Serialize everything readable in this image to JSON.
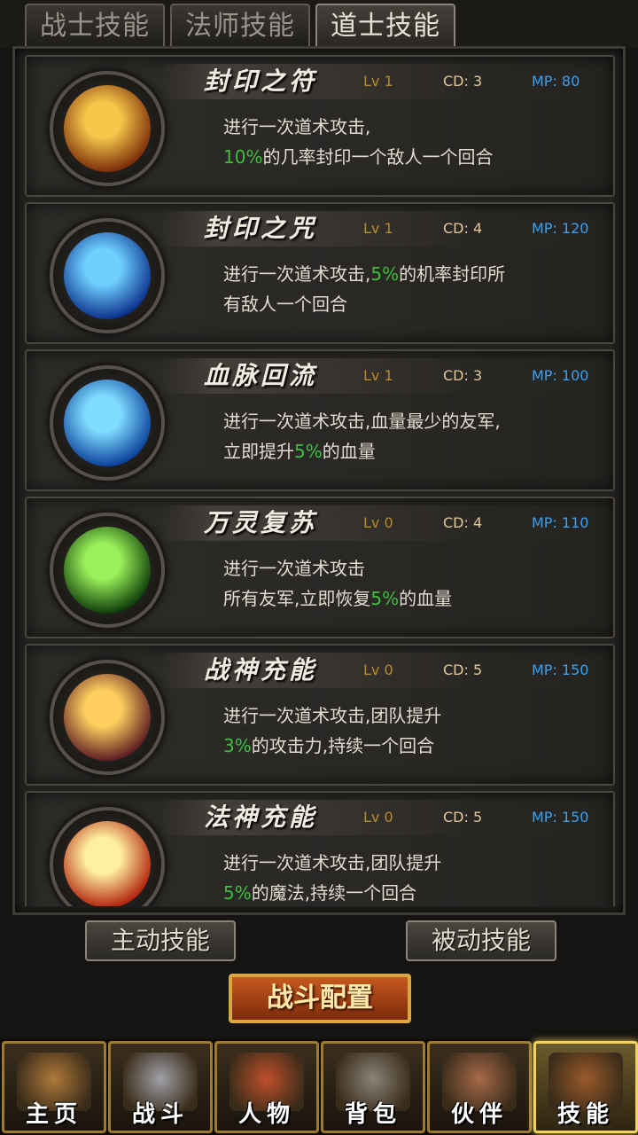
{
  "tabs": [
    "战士技能",
    "法师技能",
    "道士技能"
  ],
  "active_tab": 2,
  "skills": [
    {
      "name": "封印之符",
      "lv": "Lv 1",
      "cd": "CD: 3",
      "mp": "MP: 80",
      "desc1a": "进行一次道术攻击,",
      "desc1g": "",
      "desc1b": "",
      "desc2a": "",
      "desc2g": "10%",
      "desc2b": "的几率封印一个敌人一个回合",
      "icon": "golden-talisman-icon",
      "color1": "#f5c84a",
      "color2": "#7a2a08"
    },
    {
      "name": "封印之咒",
      "lv": "Lv 1",
      "cd": "CD: 4",
      "mp": "MP: 120",
      "desc1a": "进行一次道术攻击,",
      "desc1g": "5%",
      "desc1b": "的机率封印所",
      "desc2a": "有敌人一个回合",
      "desc2g": "",
      "desc2b": "",
      "icon": "seal-bagua-icon",
      "color1": "#6fd0ff",
      "color2": "#0a2f8a"
    },
    {
      "name": "血脉回流",
      "lv": "Lv 1",
      "cd": "CD: 3",
      "mp": "MP: 100",
      "desc1a": "进行一次道术攻击,血量最少的友军,",
      "desc1g": "",
      "desc1b": "",
      "desc2a": "立即提升",
      "desc2g": "5%",
      "desc2b": "的血量",
      "icon": "water-wave-icon",
      "color1": "#7fdcff",
      "color2": "#0a3e9a"
    },
    {
      "name": "万灵复苏",
      "lv": "Lv 0",
      "cd": "CD: 4",
      "mp": "MP: 110",
      "desc1a": "进行一次道术攻击",
      "desc1g": "",
      "desc1b": "",
      "desc2a": "所有友军,立即恢复",
      "desc2g": "5%",
      "desc2b": "的血量",
      "icon": "green-flame-icon",
      "color1": "#9af05a",
      "color2": "#0c3a08"
    },
    {
      "name": "战神充能",
      "lv": "Lv 0",
      "cd": "CD: 5",
      "mp": "MP: 150",
      "desc1a": "进行一次道术攻击,团队提升",
      "desc1g": "",
      "desc1b": "",
      "desc2a": "",
      "desc2g": "3%",
      "desc2b": "的攻击力,持续一个回合",
      "icon": "sword-burst-icon",
      "color1": "#ffd060",
      "color2": "#5a1a20"
    },
    {
      "name": "法神充能",
      "lv": "Lv 0",
      "cd": "CD: 5",
      "mp": "MP: 150",
      "desc1a": "进行一次道术攻击,团队提升",
      "desc1g": "",
      "desc1b": "",
      "desc2a": "",
      "desc2g": "5%",
      "desc2b": "的魔法,持续一个回合",
      "icon": "fire-burst-icon",
      "color1": "#fff0a0",
      "color2": "#b0200a"
    }
  ],
  "sub_buttons": {
    "active": "主动技能",
    "passive": "被动技能"
  },
  "battle_config": "战斗配置",
  "nav": [
    {
      "label": "主页",
      "icon": "palace-icon",
      "color": "#b07a3a"
    },
    {
      "label": "战斗",
      "icon": "crossed-swords-icon",
      "color": "#a0a0a8"
    },
    {
      "label": "人物",
      "icon": "warrior-portrait-icon",
      "color": "#c0502a"
    },
    {
      "label": "背包",
      "icon": "backpack-icon",
      "color": "#8a8478"
    },
    {
      "label": "伙伴",
      "icon": "handshake-icon",
      "color": "#a86a4a"
    },
    {
      "label": "技能",
      "icon": "spellbook-icon",
      "color": "#9a5a2a"
    }
  ],
  "nav_active": 5
}
